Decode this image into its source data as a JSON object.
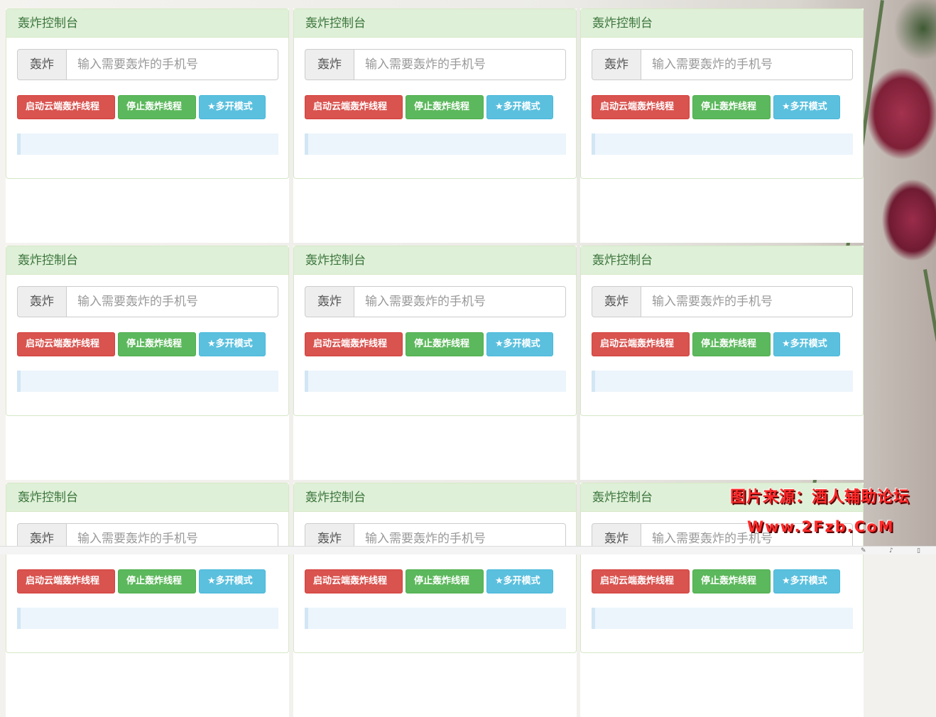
{
  "panel": {
    "title": "轰炸控制台",
    "addon_label": "轰炸",
    "input_placeholder": "输入需要轰炸的手机号",
    "start_button": "启动云端轰炸线程",
    "stop_button": "停止轰炸线程",
    "multi_button": "★多开模式"
  },
  "panels_count": 9,
  "colors": {
    "panel_header_bg": "#dff0d8",
    "panel_header_text": "#3c763d",
    "start_button": "#d9534f",
    "stop_button": "#5cb85c",
    "multi_button": "#5bc0de",
    "log_box": "#ecf5fc"
  },
  "watermark": {
    "line1": "图片来源：酒人辅助论坛",
    "line2": "Www.2Fzb.CoM"
  },
  "tray": {
    "icons": [
      "pin-icon",
      "speaker-icon",
      "trash-icon"
    ]
  }
}
